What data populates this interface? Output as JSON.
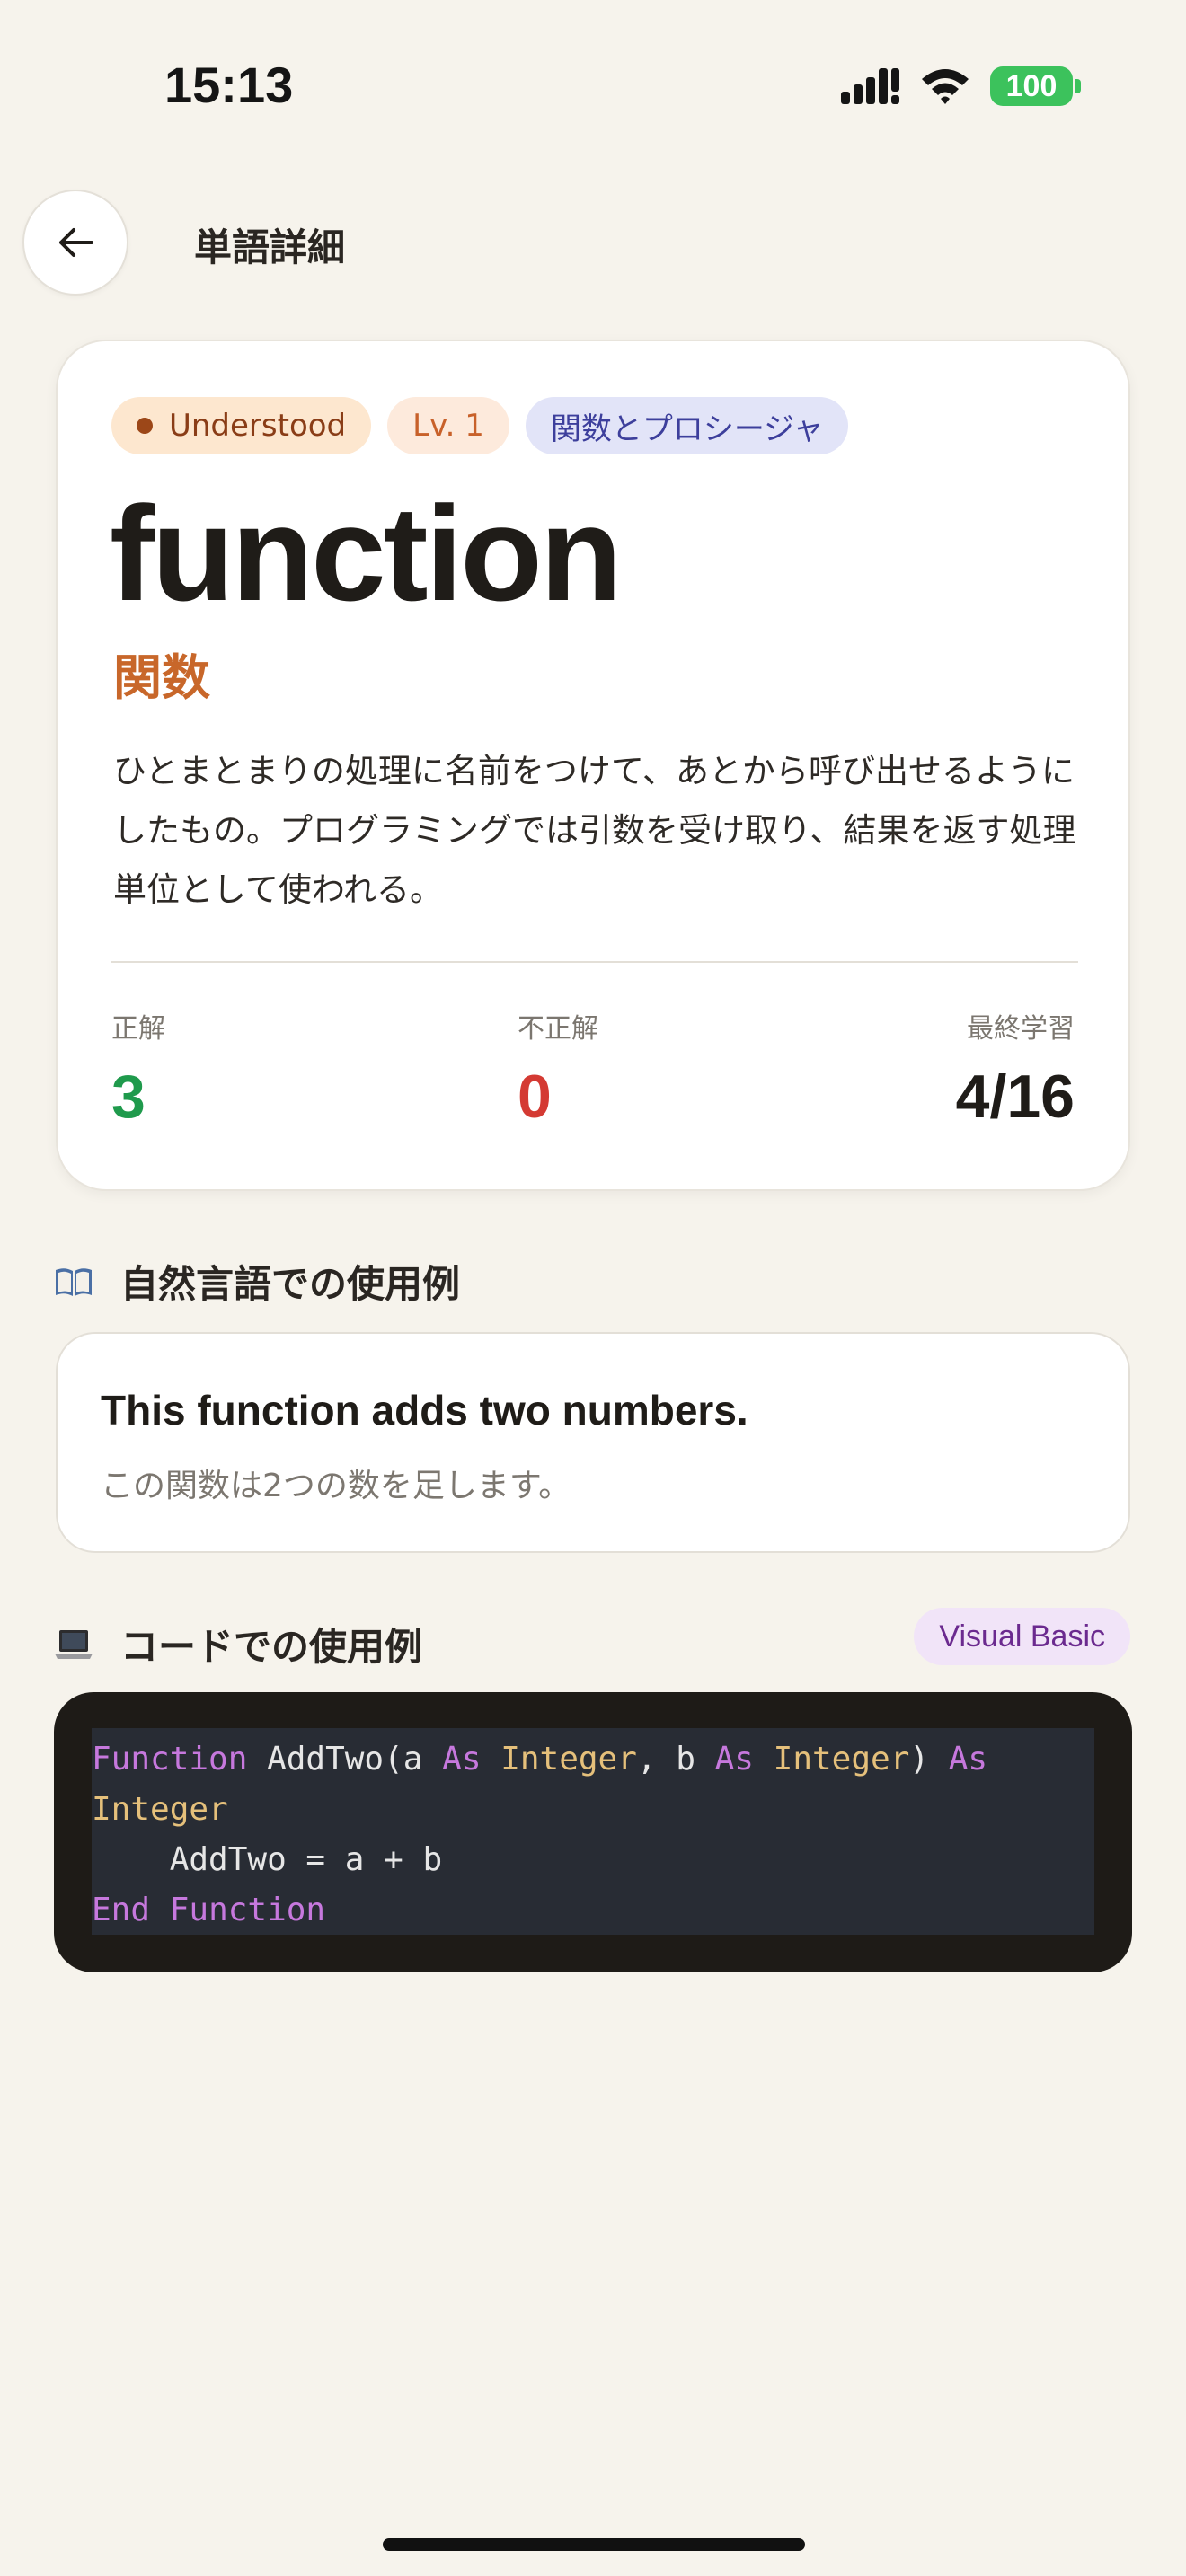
{
  "status_bar": {
    "time": "15:13",
    "battery": "100",
    "battery_color": "#3cc25c"
  },
  "header": {
    "title": "単語詳細",
    "back_icon": "arrow-left-icon"
  },
  "word": {
    "status_badge": "Understood",
    "level_badge": "Lv. 1",
    "category_badge": "関数とプロシージャ",
    "term": "function",
    "translation": "関数",
    "definition": "ひとまとまりの処理に名前をつけて、あとから呼び出せるようにしたもの。プログラミングでは引数を受け取り、結果を返す処理単位として使われる。",
    "stats": {
      "correct_label": "正解",
      "correct_value": "3",
      "incorrect_label": "不正解",
      "incorrect_value": "0",
      "last_label": "最終学習",
      "last_value": "4/16"
    }
  },
  "natural_example": {
    "icon": "open-book-icon",
    "title": "自然言語での使用例",
    "sentence": "This function adds two numbers.",
    "translation": "この関数は2つの数を足します。"
  },
  "code_example": {
    "icon": "laptop-icon",
    "title": "コードでの使用例",
    "language": "Visual Basic",
    "lines": [
      [
        {
          "t": "Function",
          "k": "kw"
        },
        {
          "t": " AddTwo(a ",
          "k": "plain"
        },
        {
          "t": "As",
          "k": "kw"
        },
        {
          "t": " ",
          "k": "plain"
        },
        {
          "t": "Integer",
          "k": "type"
        },
        {
          "t": ", b ",
          "k": "plain"
        },
        {
          "t": "As",
          "k": "kw"
        },
        {
          "t": " ",
          "k": "plain"
        },
        {
          "t": "Integer",
          "k": "type"
        },
        {
          "t": ") ",
          "k": "plain"
        },
        {
          "t": "As",
          "k": "kw"
        }
      ],
      [
        {
          "t": "Integer",
          "k": "type"
        }
      ],
      [
        {
          "t": "    AddTwo = a + b",
          "k": "plain"
        }
      ],
      [
        {
          "t": "End",
          "k": "kw"
        },
        {
          "t": " ",
          "k": "plain"
        },
        {
          "t": "Function",
          "k": "kw"
        }
      ]
    ]
  }
}
